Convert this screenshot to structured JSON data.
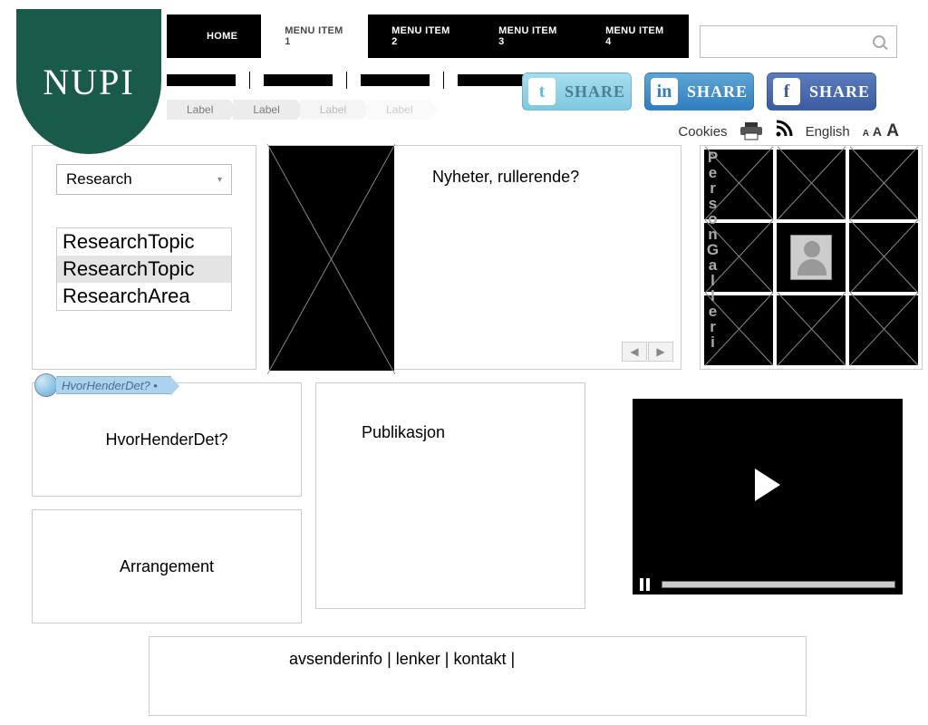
{
  "logo_text": "NUPI",
  "nav": {
    "items": [
      "HOME",
      "MENU ITEM 1",
      "MENU ITEM 2",
      "MENU ITEM 3",
      "MENU ITEM 4"
    ],
    "active_index": 1
  },
  "search": {
    "value": ""
  },
  "share": {
    "label": "SHARE"
  },
  "utilities": {
    "cookies": "Cookies",
    "language": "English"
  },
  "breadcrumb": [
    "Label",
    "Label",
    "Label",
    "Label"
  ],
  "sidebar": {
    "dropdown_label": "Research",
    "list": [
      "ResearchTopic",
      "ResearchTopic",
      "ResearchArea"
    ],
    "selected_index": 1
  },
  "news": {
    "title": "Nyheter, rullerende?"
  },
  "gallery": {
    "label": "PersonGalleri"
  },
  "hhd_badge": "HvorHenderDet? •",
  "boxes": {
    "hhd": "HvorHenderDet?",
    "arr": "Arrangement",
    "pub": "Publikasjon"
  },
  "footer": "avsenderinfo | lenker | kontakt |"
}
